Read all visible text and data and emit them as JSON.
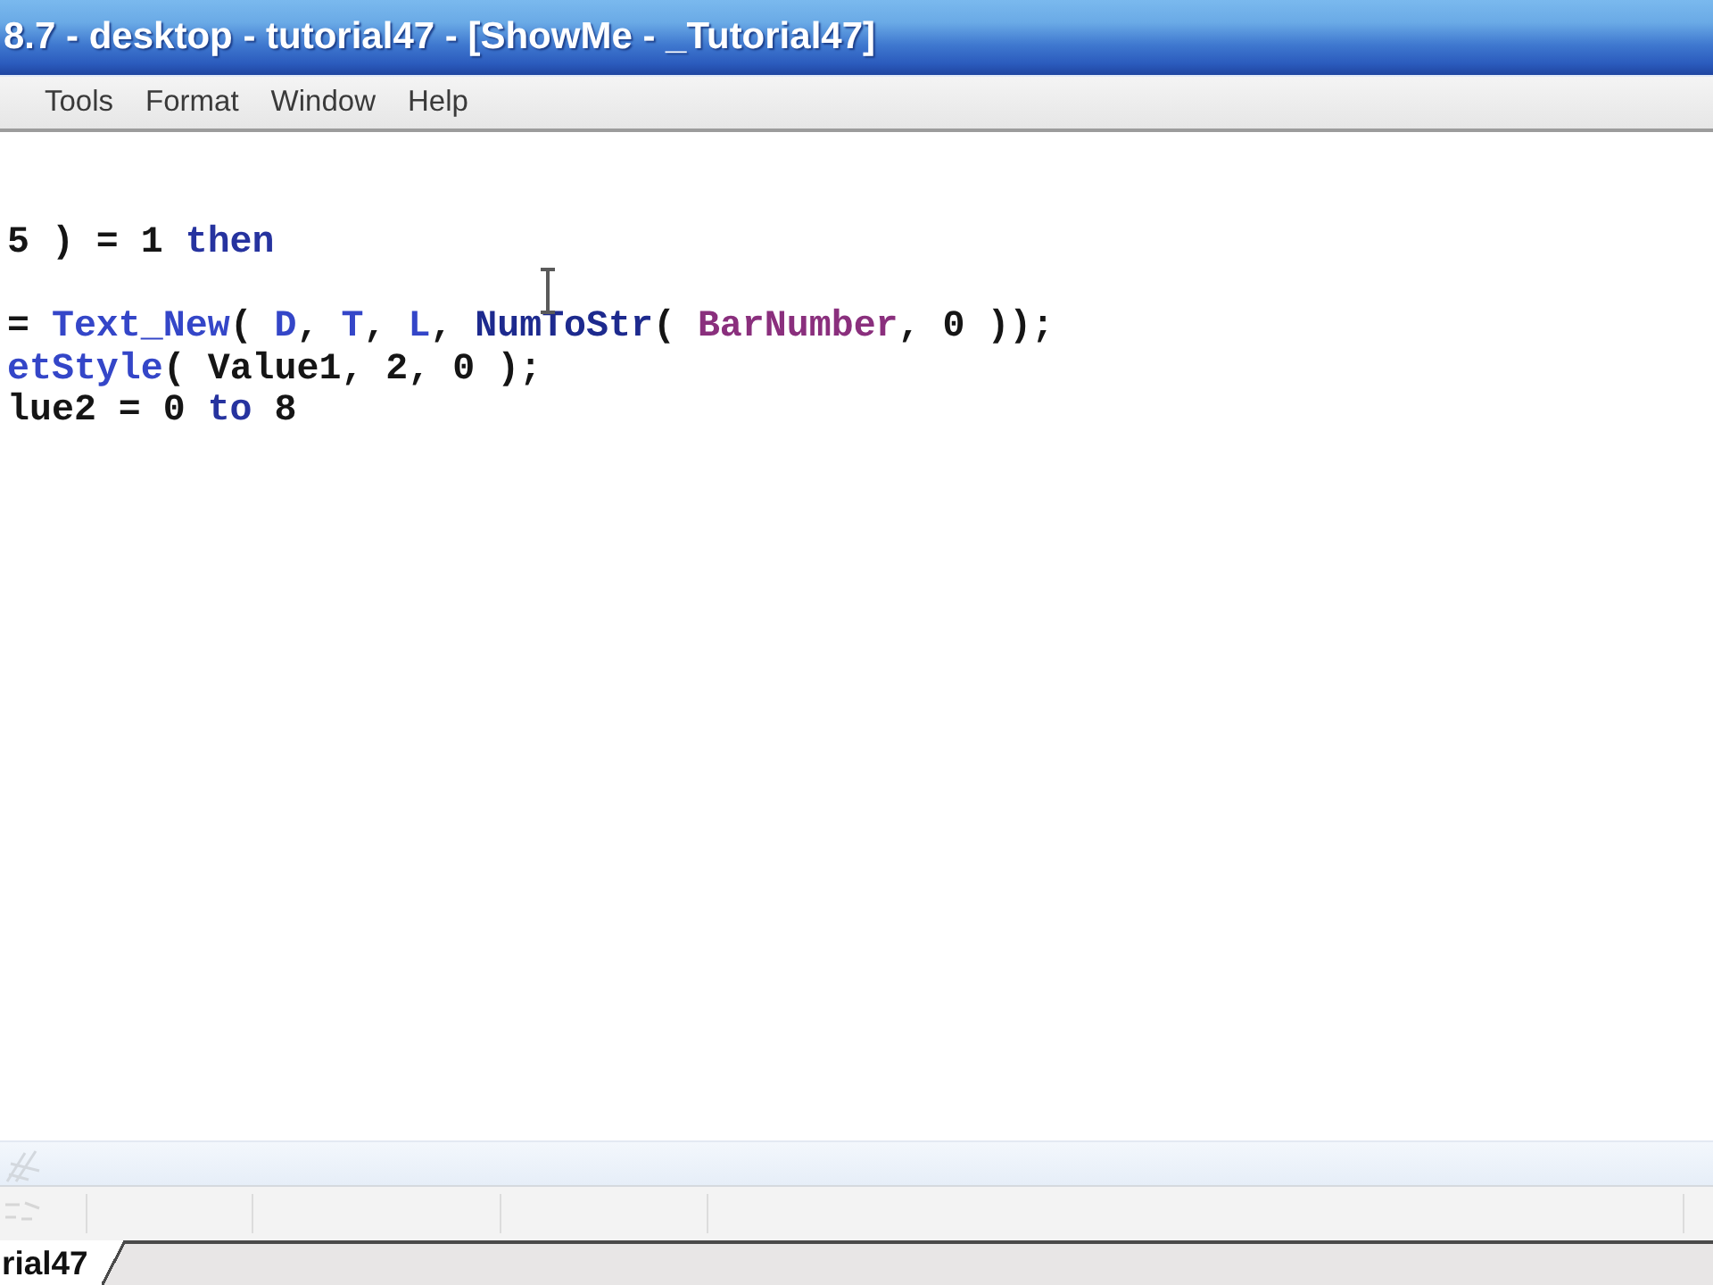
{
  "window": {
    "title": "8.7 - desktop - tutorial47 - [ShowMe - _Tutorial47]"
  },
  "menu_bar": [
    {
      "label": "Tools"
    },
    {
      "label": "Format"
    },
    {
      "label": "Window"
    },
    {
      "label": "Help"
    }
  ],
  "editor": {
    "lines": [
      {
        "kind": "code",
        "tokens": [
          {
            "kind": "plain",
            "text": "5 ) = 1 "
          },
          {
            "kind": "keyword",
            "text": "then"
          }
        ]
      },
      {
        "kind": "blank"
      },
      {
        "kind": "code",
        "tokens": [
          {
            "kind": "plain",
            "text": "= "
          },
          {
            "kind": "function",
            "text": "Text_New"
          },
          {
            "kind": "plain",
            "text": "( "
          },
          {
            "kind": "function",
            "text": "D"
          },
          {
            "kind": "plain",
            "text": ", "
          },
          {
            "kind": "function",
            "text": "T"
          },
          {
            "kind": "plain",
            "text": ", "
          },
          {
            "kind": "function",
            "text": "L"
          },
          {
            "kind": "plain",
            "text": ", "
          },
          {
            "kind": "builtin",
            "text": "NumToStr"
          },
          {
            "kind": "plain",
            "text": "( "
          },
          {
            "kind": "reserved",
            "text": "BarNumber"
          },
          {
            "kind": "plain",
            "text": ", 0 ));"
          }
        ]
      },
      {
        "kind": "code",
        "tokens": [
          {
            "kind": "function",
            "text": "etStyle"
          },
          {
            "kind": "plain",
            "text": "( Value1, 2, 0 );"
          }
        ]
      },
      {
        "kind": "code",
        "tokens": [
          {
            "kind": "plain",
            "text": "lue2 = 0 "
          },
          {
            "kind": "keyword",
            "text": "to"
          },
          {
            "kind": "plain",
            "text": " 8"
          }
        ]
      }
    ]
  },
  "document_tabs": [
    {
      "label": "rial47",
      "selected": true
    }
  ]
}
